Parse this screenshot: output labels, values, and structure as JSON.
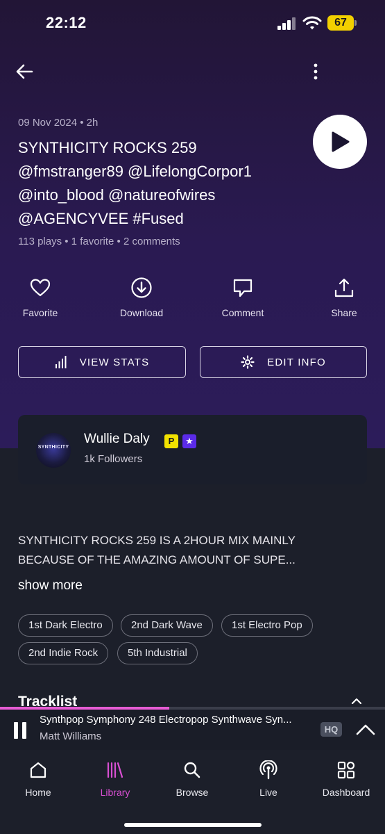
{
  "status_bar": {
    "time": "22:12",
    "battery": "67"
  },
  "track": {
    "date_duration": "09 Nov 2024 • 2h",
    "title": "SYNTHICITY ROCKS 259 @fmstranger89 @LifelongCorpor1 @into_blood @natureofwires @AGENCYVEE #Fused",
    "stats": "113 plays • 1 favorite • 2 comments"
  },
  "actions": {
    "favorite": "Favorite",
    "download": "Download",
    "comment": "Comment",
    "share": "Share"
  },
  "buttons": {
    "view_stats": "VIEW STATS",
    "edit_info": "EDIT INFO"
  },
  "artist": {
    "name": "Wullie Daly",
    "badge_p": "P",
    "badge_star": "★",
    "followers": "1k Followers",
    "avatar_logo_text": "SYNTHICITY"
  },
  "description": {
    "text": "SYNTHICITY ROCKS 259 IS A 2HOUR MIX MAINLY BECAUSE OF THE AMAZING AMOUNT OF SUPE...",
    "show_more": "show more"
  },
  "tags": [
    "1st Dark Electro",
    "2nd Dark Wave",
    "1st Electro Pop",
    "2nd Indie Rock",
    "5th Industrial"
  ],
  "tracklist": {
    "title": "Tracklist"
  },
  "player": {
    "track_title": "Synthpop Symphony 248 Electropop Synthwave Syn...",
    "artist": "Matt Williams",
    "quality": "HQ",
    "progress": 0.44,
    "progress_color": "#e55bd3"
  },
  "nav": [
    {
      "label": "Home",
      "icon": "home-icon"
    },
    {
      "label": "Library",
      "icon": "library-icon",
      "active": true
    },
    {
      "label": "Browse",
      "icon": "search-icon"
    },
    {
      "label": "Live",
      "icon": "live-icon"
    },
    {
      "label": "Dashboard",
      "icon": "dashboard-icon"
    }
  ],
  "colors": {
    "accent": "#d84fd2",
    "hero_bg": "#2a1a52",
    "surface": "#1c1f2a"
  }
}
